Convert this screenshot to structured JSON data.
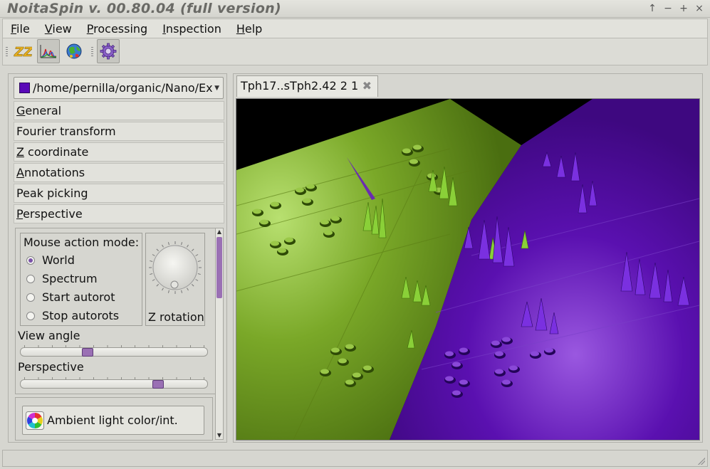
{
  "window": {
    "title": "NoitaSpin v. 00.80.04 (full version)",
    "controls": [
      "↑",
      "−",
      "+",
      "×"
    ]
  },
  "menu": [
    {
      "pre": "",
      "acc": "F",
      "post": "ile"
    },
    {
      "pre": "",
      "acc": "V",
      "post": "iew"
    },
    {
      "pre": "",
      "acc": "P",
      "post": "rocessing"
    },
    {
      "pre": "",
      "acc": "I",
      "post": "nspection"
    },
    {
      "pre": "",
      "acc": "H",
      "post": "elp"
    }
  ],
  "toolbar": {
    "buttons": [
      {
        "name": "zz-icon",
        "pressed": false
      },
      {
        "name": "spectrum-plot-icon",
        "pressed": true
      },
      {
        "name": "globe-icon",
        "pressed": false
      },
      {
        "name": "settings-gear-icon",
        "pressed": false
      }
    ]
  },
  "dataset": {
    "path": "/home/pernilla/organic/Nano/Ex",
    "swatch_color": "#5a0ab8"
  },
  "sections": [
    {
      "pre": "",
      "acc": "G",
      "post": "eneral"
    },
    {
      "pre": "",
      "acc": "",
      "post": "Fourier transform"
    },
    {
      "pre": "",
      "acc": "Z",
      "post": " coordinate"
    },
    {
      "pre": "",
      "acc": "A",
      "post": "nnotations"
    },
    {
      "pre": "",
      "acc": "",
      "post": "Peak picking"
    },
    {
      "pre": "",
      "acc": "P",
      "post": "erspective"
    }
  ],
  "perspective": {
    "mouse_mode_label": "Mouse action mode:",
    "modes": [
      {
        "label": "World",
        "selected": true
      },
      {
        "label": "Spectrum",
        "selected": false
      },
      {
        "label": "Start autorot",
        "selected": false
      },
      {
        "label": "Stop autorots",
        "selected": false
      }
    ],
    "z_rotation_label": "Z rotation",
    "view_angle_label": "View angle",
    "view_angle_value": 0.35,
    "perspective_label": "Perspective",
    "perspective_value": 0.75,
    "ambient_button_label": "Ambient light color/int."
  },
  "tab": {
    "label": "Tph17..sTph2.42 2 1",
    "close": "✖"
  },
  "colors": {
    "spectrum_a": "#6a9a18",
    "spectrum_b": "#5a10b0",
    "accent": "#9a70b4"
  }
}
